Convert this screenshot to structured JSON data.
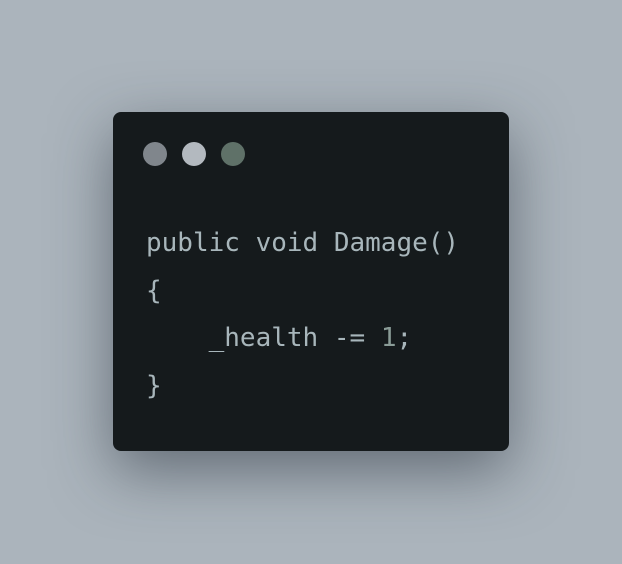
{
  "window": {
    "dots": [
      {
        "name": "close",
        "color": "#80868c"
      },
      {
        "name": "minimize",
        "color": "#b3b9bf"
      },
      {
        "name": "maximize",
        "color": "#5f7168"
      }
    ]
  },
  "code": {
    "lines": [
      {
        "text": "public void Damage()"
      },
      {
        "text": "{"
      },
      {
        "prefix": "    _health -= ",
        "number": "1",
        "suffix": ";"
      },
      {
        "text": "}"
      }
    ]
  }
}
